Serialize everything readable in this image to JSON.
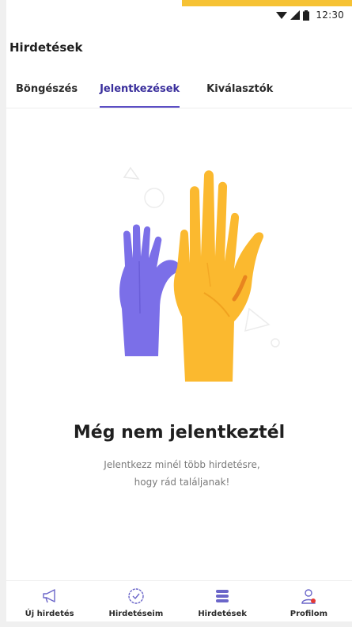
{
  "status_bar": {
    "time": "12:30"
  },
  "app_bar": {
    "title": "Hirdetések"
  },
  "tabs": [
    {
      "label": "Böngészés",
      "active": false
    },
    {
      "label": "Jelentkezések",
      "active": true
    },
    {
      "label": "Kiválasztók",
      "active": false
    }
  ],
  "empty_state": {
    "illustration": "raised-hands-illustration",
    "title": "Még nem jelentkeztél",
    "subtitle_line1": "Jelentkezz minél több hirdetésre,",
    "subtitle_line2": "hogy rád találjanak!"
  },
  "bottom_nav": [
    {
      "label": "Új hirdetés",
      "icon": "megaphone-icon"
    },
    {
      "label": "Hirdetéseim",
      "icon": "check-circle-icon"
    },
    {
      "label": "Hirdetések",
      "icon": "list-stack-icon"
    },
    {
      "label": "Profilom",
      "icon": "user-icon"
    }
  ],
  "colors": {
    "accent": "#5b4ec4",
    "hand_purple": "#7b6fe8",
    "hand_yellow": "#fbb92f",
    "top_accent": "#f6c234",
    "notification_dot": "#e53935"
  }
}
